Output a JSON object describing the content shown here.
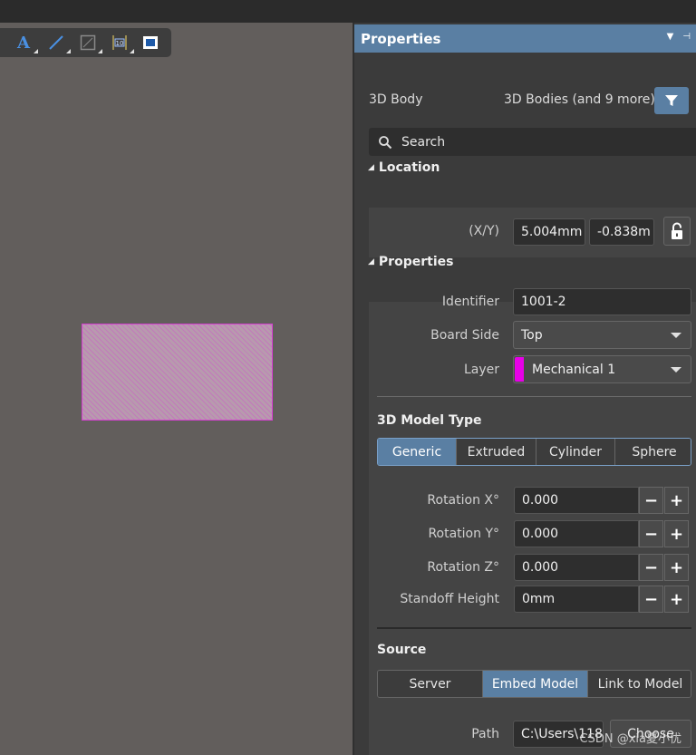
{
  "toolbar": {
    "tools": [
      {
        "icon": "text-tool-icon",
        "glyph": "A"
      },
      {
        "icon": "line-tool-icon"
      },
      {
        "icon": "pad-tool-icon"
      },
      {
        "icon": "dimension-tool-icon",
        "glyph": "10"
      },
      {
        "icon": "rectangle-tool-icon"
      }
    ]
  },
  "component": {
    "fill_color": "#b89aae",
    "outline_color": "#d43fd0"
  },
  "panel": {
    "title": "Properties",
    "object_type": "3D Body",
    "selection_summary": "3D Bodies (and 9 more)",
    "search_placeholder": "Search",
    "location": {
      "heading": "Location",
      "xy_label": "(X/Y)",
      "x_value": "5.004mm",
      "y_value": "-0.838m"
    },
    "properties": {
      "heading": "Properties",
      "identifier_label": "Identifier",
      "identifier_value": "1001-2",
      "board_side_label": "Board Side",
      "board_side_value": "Top",
      "layer_label": "Layer",
      "layer_value": "Mechanical 1",
      "layer_color": "#e800e8"
    },
    "model_type": {
      "heading": "3D Model Type",
      "options": [
        "Generic",
        "Extruded",
        "Cylinder",
        "Sphere"
      ],
      "selected": "Generic"
    },
    "rotation": {
      "x_label": "Rotation X°",
      "x_value": "0.000",
      "y_label": "Rotation Y°",
      "y_value": "0.000",
      "z_label": "Rotation Z°",
      "z_value": "0.000",
      "standoff_label": "Standoff Height",
      "standoff_value": "0mm",
      "minus": "−",
      "plus": "+"
    },
    "source": {
      "heading": "Source",
      "options": [
        "Server",
        "Embed Model",
        "Link to Model"
      ],
      "selected": "Embed Model",
      "path_label": "Path",
      "path_value": "C:\\Users\\118",
      "choose_label": "Choose"
    },
    "accent_color": "#5a7fa3"
  },
  "watermark": "CSDN @xia夏小优"
}
